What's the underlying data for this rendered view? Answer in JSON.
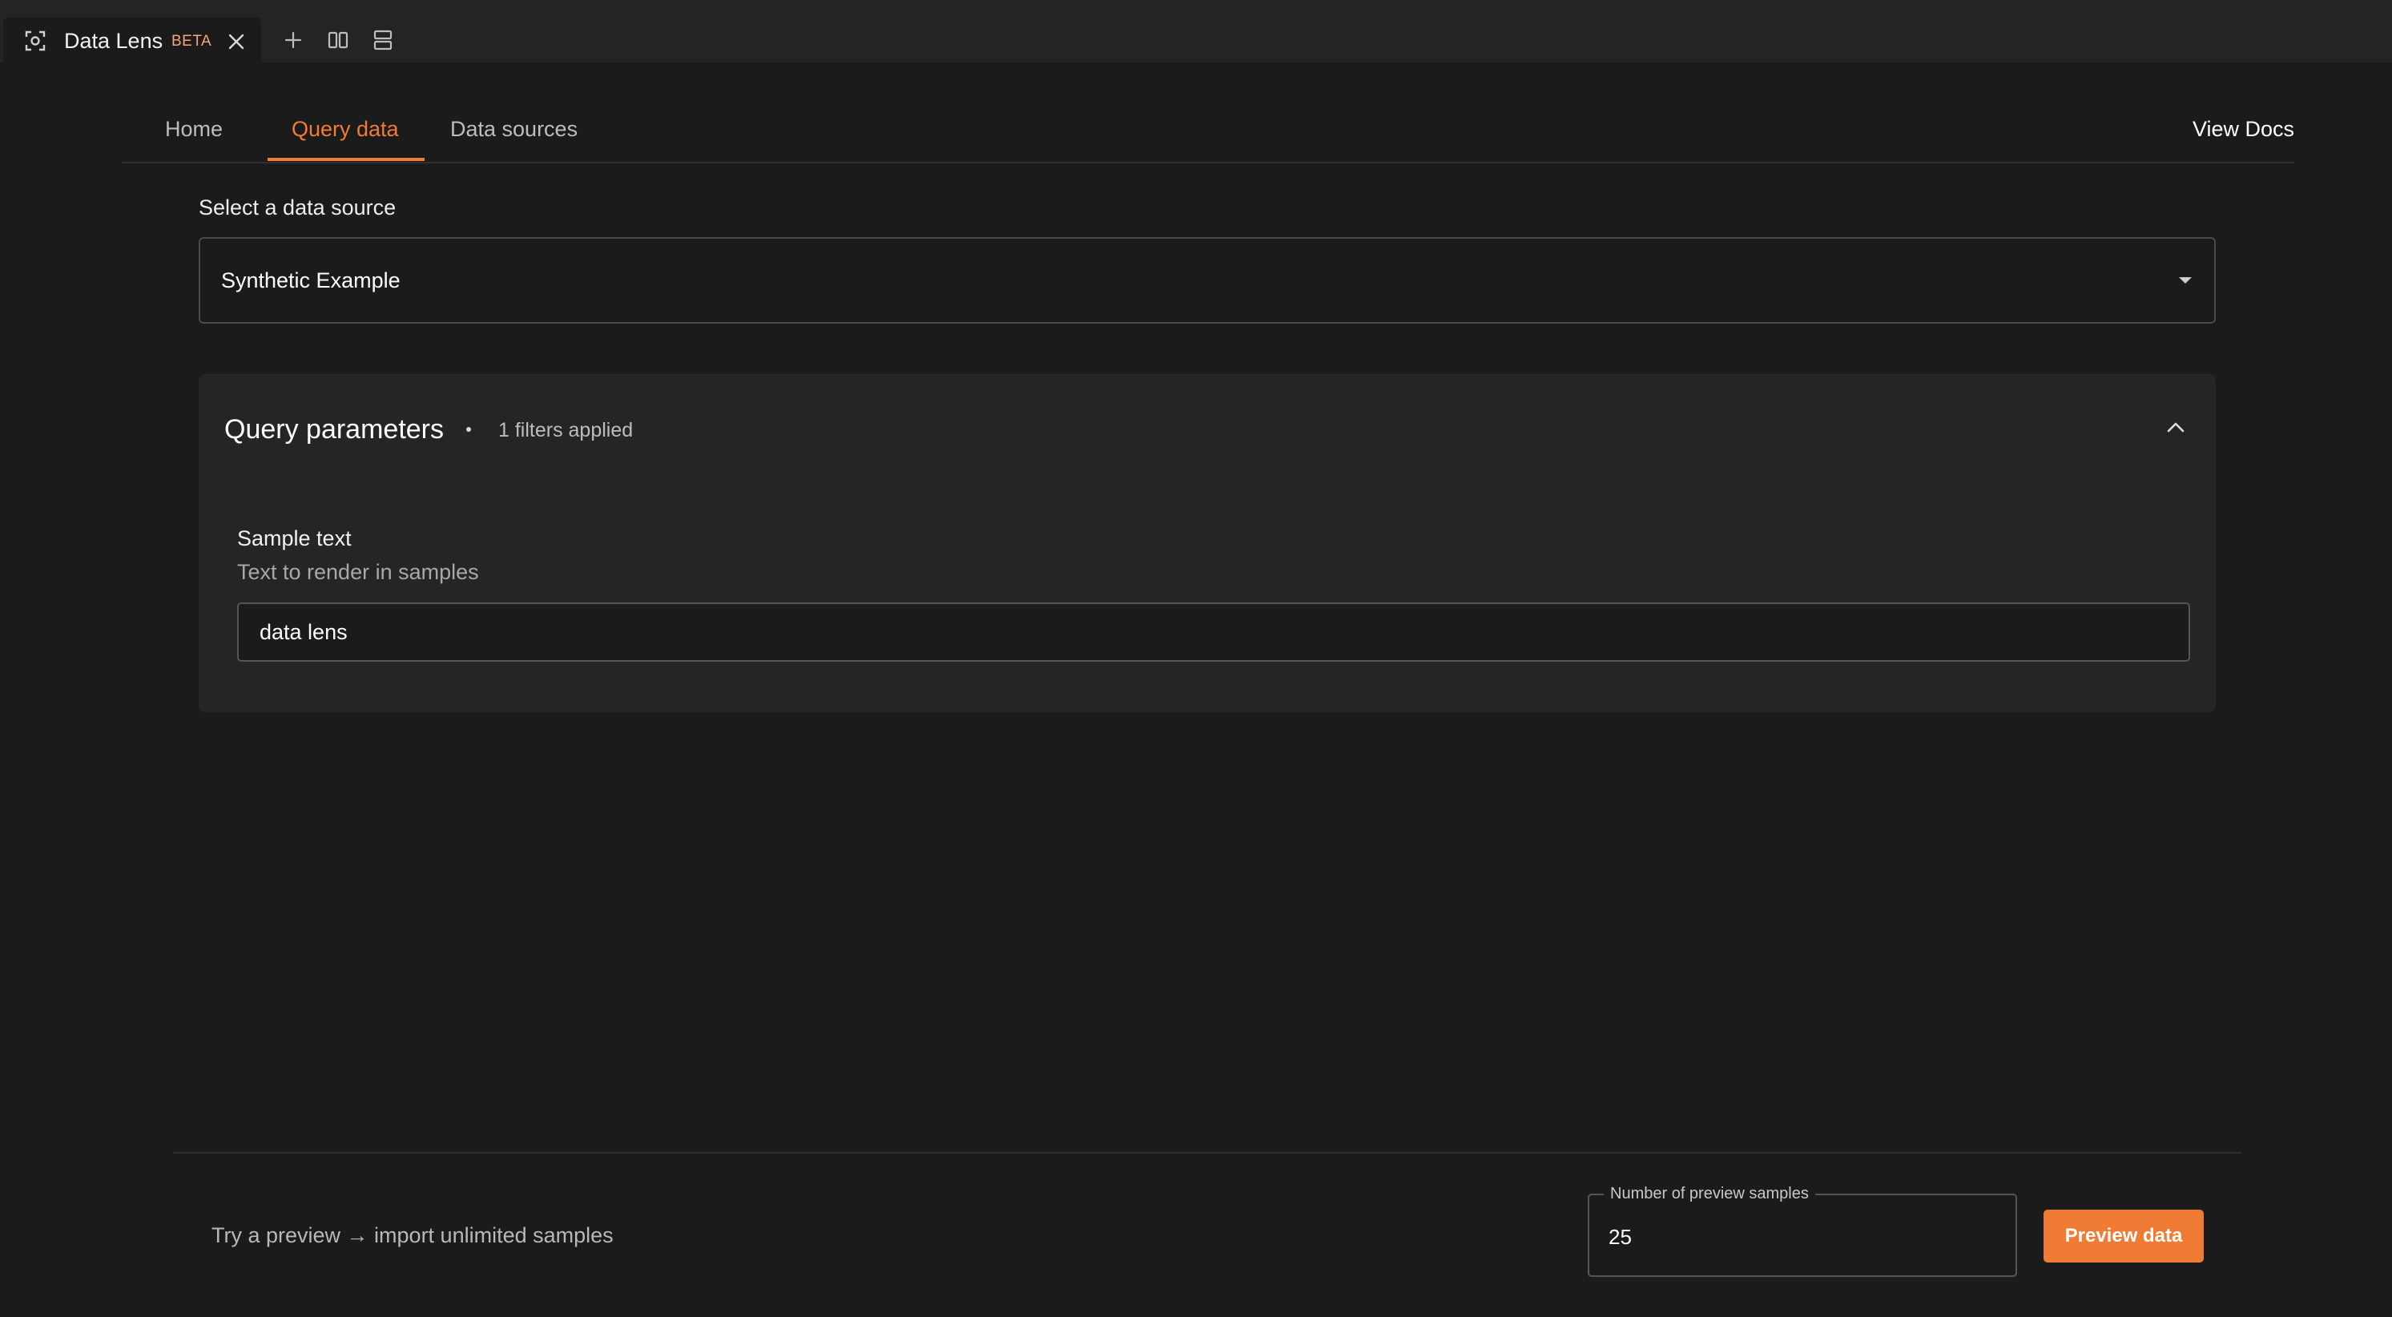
{
  "tabbar": {
    "tab": {
      "title": "Data Lens",
      "badge": "BETA",
      "icon": "lens-scan-icon"
    },
    "tools": [
      "plus-icon",
      "split-horizontal-icon",
      "split-vertical-icon"
    ]
  },
  "nav": {
    "tabs": [
      {
        "label": "Home",
        "active": false
      },
      {
        "label": "Query data",
        "active": true
      },
      {
        "label": "Data sources",
        "active": false
      }
    ],
    "docs_link": "View Docs"
  },
  "source": {
    "label": "Select a data source",
    "selected": "Synthetic Example"
  },
  "query_params": {
    "title": "Query parameters",
    "filters_applied": "1 filters applied",
    "field": {
      "label": "Sample text",
      "description": "Text to render in samples",
      "value": "data lens"
    }
  },
  "footer": {
    "hint": "Try a preview → import unlimited samples",
    "samples_label": "Number of preview samples",
    "samples_value": "25",
    "preview_button": "Preview data"
  },
  "colors": {
    "accent": "#f07b34",
    "background": "#1b1b1b",
    "panel": "#252525",
    "badge": "#f5a77a"
  }
}
